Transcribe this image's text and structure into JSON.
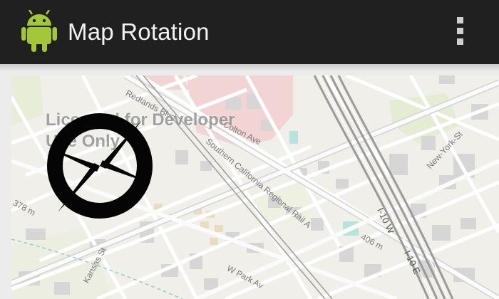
{
  "app": {
    "title": "Map Rotation",
    "icon": "android-robot-icon",
    "accent_color": "#a4c639"
  },
  "actionbar": {
    "background": "#202020",
    "overflow_icon": "more-vert-icon"
  },
  "map": {
    "watermark": {
      "line1": "Licensed for Developer",
      "line2": "Use Only"
    },
    "compass_icon": "compass-icon",
    "labels": {
      "redlands": "Redlands Blvd",
      "colton": "Colton Ave",
      "southern_california": "Southern California Regional Rail A",
      "new_york": "New-York-St",
      "i10w": "I-10 W",
      "i10e": "I-10 E",
      "elevation_406": "406 m",
      "elevation_378": "378 m",
      "kansas": "Kansas St",
      "park": "W Park Av"
    }
  }
}
